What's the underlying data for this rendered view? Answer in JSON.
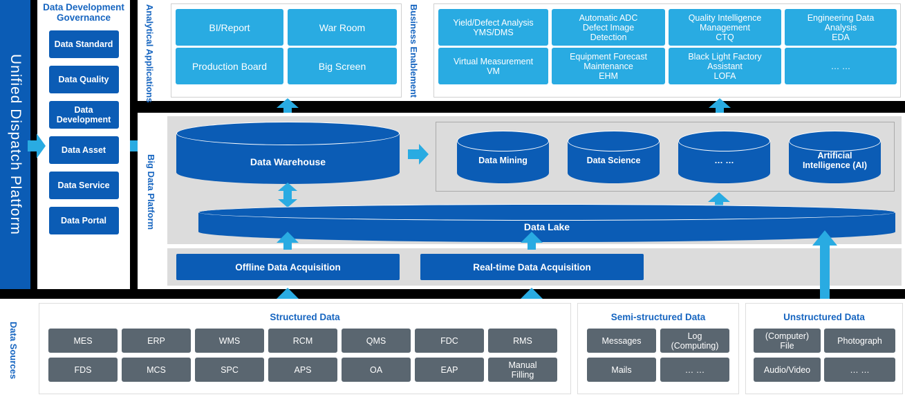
{
  "platform": {
    "title": "Unified Dispatch Platform"
  },
  "governance": {
    "title": "Data Development Governance",
    "items": [
      {
        "label": "Data Standard"
      },
      {
        "label": "Data Quality"
      },
      {
        "label": "Data Development"
      },
      {
        "label": "Data Asset"
      },
      {
        "label": "Data Service"
      },
      {
        "label": "Data Portal"
      }
    ]
  },
  "analytical": {
    "label": "Analytical Applications",
    "cards": [
      {
        "label": "BI/Report"
      },
      {
        "label": "War Room"
      },
      {
        "label": "Production Board"
      },
      {
        "label": "Big Screen"
      }
    ]
  },
  "business": {
    "label": "Business Enablement",
    "cards": [
      {
        "line1": "Yield/Defect Analysis",
        "line2": "YMS/DMS",
        "line3": ""
      },
      {
        "line1": "Automatic ADC",
        "line2": "Defect Image",
        "line3": "Detection"
      },
      {
        "line1": "Quality Intelligence",
        "line2": "Management",
        "line3": "CTQ"
      },
      {
        "line1": "Engineering Data",
        "line2": "Analysis",
        "line3": "EDA"
      },
      {
        "line1": "Virtual Measurement",
        "line2": "VM",
        "line3": ""
      },
      {
        "line1": "Equipment Forecast",
        "line2": "Maintenance",
        "line3": "EHM"
      },
      {
        "line1": "Black Light Factory",
        "line2": "Assistant",
        "line3": "LOFA"
      },
      {
        "line1": "… …",
        "line2": "",
        "line3": ""
      }
    ]
  },
  "bigdata": {
    "label": "Big Data Platform",
    "warehouse": {
      "label": "Data Warehouse"
    },
    "lake": {
      "label": "Data Lake"
    },
    "analytics_cylinders": [
      {
        "line1": "Data Mining",
        "line2": ""
      },
      {
        "line1": "Data Science",
        "line2": ""
      },
      {
        "line1": "… …",
        "line2": ""
      },
      {
        "line1": "Artificial",
        "line2": "Intelligence (AI)"
      }
    ],
    "acquisition": [
      {
        "label": "Offline Data Acquisition"
      },
      {
        "label": "Real-time Data Acquisition"
      }
    ]
  },
  "sources": {
    "label": "Data Sources",
    "groups": [
      {
        "title": "Structured Data",
        "row1": [
          {
            "line1": "MES",
            "line2": ""
          },
          {
            "line1": "ERP",
            "line2": ""
          },
          {
            "line1": "WMS",
            "line2": ""
          },
          {
            "line1": "RCM",
            "line2": ""
          },
          {
            "line1": "QMS",
            "line2": ""
          },
          {
            "line1": "FDC",
            "line2": ""
          },
          {
            "line1": "RMS",
            "line2": ""
          }
        ],
        "row2": [
          {
            "line1": "FDS",
            "line2": ""
          },
          {
            "line1": "MCS",
            "line2": ""
          },
          {
            "line1": "SPC",
            "line2": ""
          },
          {
            "line1": "APS",
            "line2": ""
          },
          {
            "line1": "OA",
            "line2": ""
          },
          {
            "line1": "EAP",
            "line2": ""
          },
          {
            "line1": "Manual",
            "line2": "Filling"
          }
        ]
      },
      {
        "title": "Semi-structured Data",
        "row1": [
          {
            "line1": "Messages",
            "line2": ""
          },
          {
            "line1": "Log",
            "line2": "(Computing)"
          }
        ],
        "row2": [
          {
            "line1": "Mails",
            "line2": ""
          },
          {
            "line1": "… …",
            "line2": ""
          }
        ]
      },
      {
        "title": "Unstructured Data",
        "row1": [
          {
            "line1": "(Computer)",
            "line2": "File"
          },
          {
            "line1": "Photograph",
            "line2": ""
          }
        ],
        "row2": [
          {
            "line1": "Audio/Video",
            "line2": ""
          },
          {
            "line1": "… …",
            "line2": ""
          }
        ]
      }
    ]
  },
  "colors": {
    "dark_blue": "#0B5CB5",
    "light_blue": "#29ABE2",
    "grey_box": "#5A6670",
    "panel_grey": "#dcdcdc",
    "title_blue": "#1665C0",
    "frame_black": "#000000"
  }
}
